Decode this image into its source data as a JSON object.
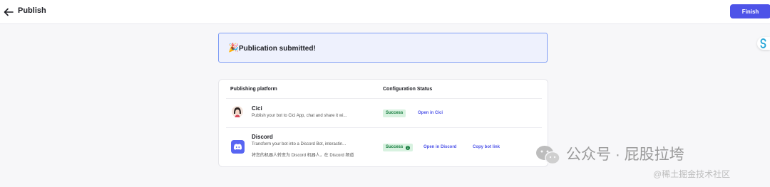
{
  "header": {
    "title": "Publish",
    "finish_label": "Finish"
  },
  "banner": {
    "icon": "party-popper",
    "message": "Publication submitted!"
  },
  "table": {
    "columns": [
      "Publishing platform",
      "Configuration Status"
    ],
    "rows": [
      {
        "name": "Cici",
        "description": "Publish your bot to Cici App, chat and share it wi...",
        "status": "Success",
        "actions": [
          "Open in Cici"
        ]
      },
      {
        "name": "Discord",
        "description": "Transform your bot into a Discord Bot, interactin...",
        "description_cn": "将您的机器人转变为 Discord 机器人，在 Discord 频道",
        "status": "Success",
        "actions": [
          "Open in Discord",
          "Copy bot link"
        ]
      }
    ]
  },
  "watermark": {
    "line1": "公众号 · 屁股拉垮",
    "line2": "@稀土掘金技术社区"
  },
  "colors": {
    "accent": "#4d53e8",
    "success_bg": "#d8f2e0",
    "success_text": "#127a3b",
    "discord": "#5865f2"
  }
}
